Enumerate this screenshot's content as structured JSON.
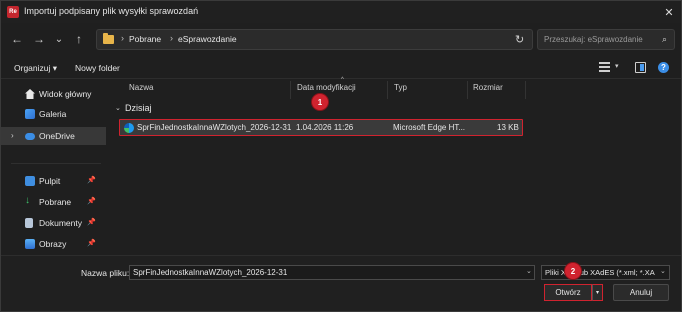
{
  "window": {
    "title": "Importuj podpisany plik wysyłki sprawozdań",
    "app_icon_text": "Re",
    "close_glyph": "✕"
  },
  "nav": {
    "back_glyph": "←",
    "forward_glyph": "→",
    "recent_glyph": "⌄",
    "up_glyph": "↑",
    "breadcrumb": [
      "Pobrane",
      "eSprawozdanie"
    ],
    "separator": "›",
    "search_placeholder": "Przeszukaj: eSprawozdanie"
  },
  "toolbar": {
    "organize": "Organizuj ▾",
    "new_folder": "Nowy folder"
  },
  "sidebar": {
    "items": [
      {
        "label": "Widok główny",
        "icon": "home-icon"
      },
      {
        "label": "Galeria",
        "icon": "gallery-icon"
      },
      {
        "label": "OneDrive",
        "icon": "cloud-icon",
        "selected": true
      },
      {
        "label": "Pulpit",
        "icon": "desktop-icon",
        "pinned": true
      },
      {
        "label": "Pobrane",
        "icon": "download-icon",
        "pinned": true
      },
      {
        "label": "Dokumenty",
        "icon": "documents-icon",
        "pinned": true
      },
      {
        "label": "Obrazy",
        "icon": "pictures-icon",
        "pinned": true
      }
    ]
  },
  "filelist": {
    "columns": [
      "Nazwa",
      "Data modyfikacji",
      "Typ",
      "Rozmiar"
    ],
    "group": "Dzisiaj",
    "rows": [
      {
        "name": "SprFinJednostkaInnaWZlotych_2026-12-31",
        "modified": "1.04.2026 11:26",
        "type": "Microsoft Edge HT...",
        "size": "13 KB",
        "icon": "edge-icon"
      }
    ]
  },
  "bottom": {
    "filename_label": "Nazwa pliku:",
    "filename_value": "SprFinJednostkaInnaWZlotych_2026-12-31",
    "filter_value": "Pliki XML lub XAdES (*.xml; *.XA",
    "open_label": "Otwórz",
    "cancel_label": "Anuluj"
  },
  "markers": [
    "1",
    "2"
  ],
  "colors": {
    "highlight": "#d0232f",
    "background": "#1f1f1f",
    "selected_row": "#3a3a3a"
  }
}
